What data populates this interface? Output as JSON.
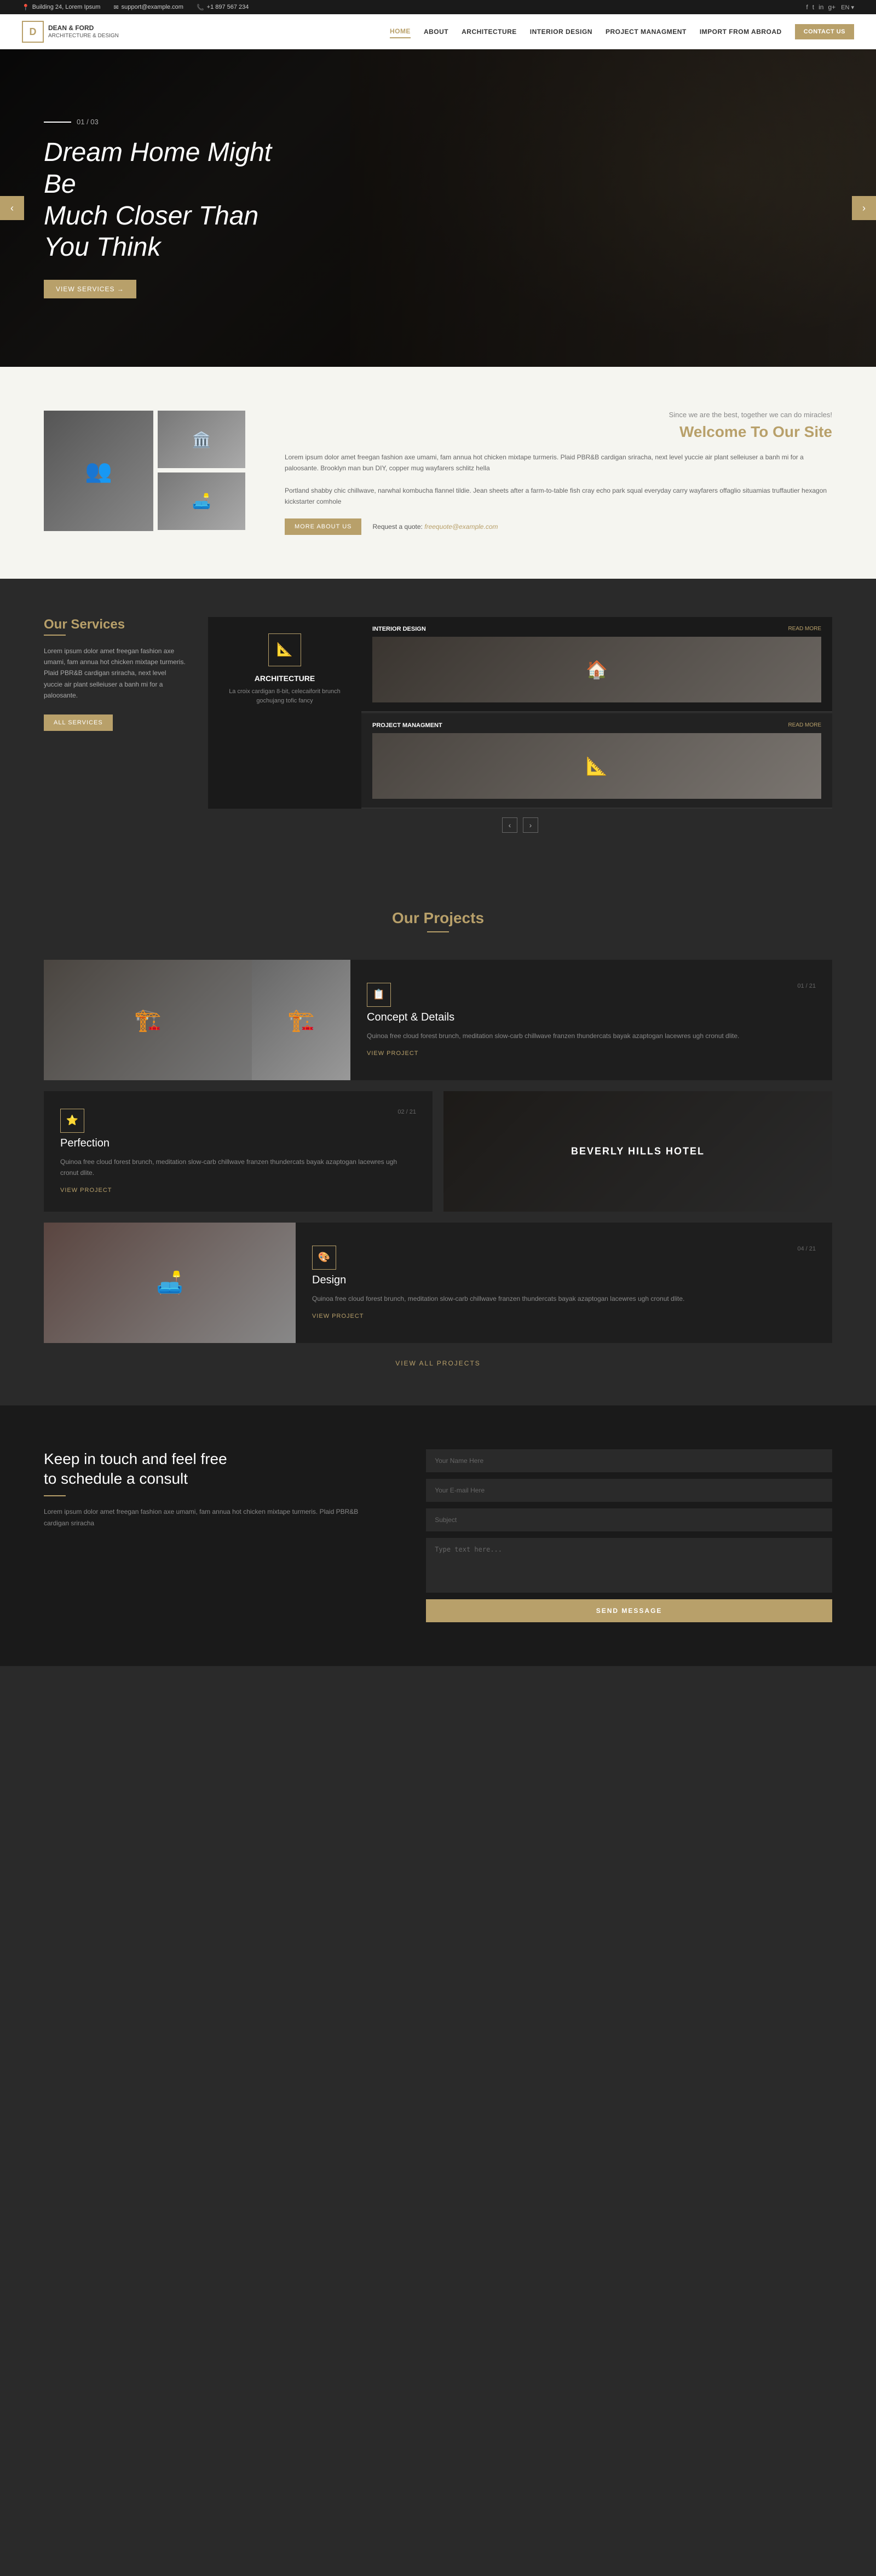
{
  "topbar": {
    "address": "Building 24, Lorem Ipsum",
    "email": "support@example.com",
    "phone": "+1 897 567 234",
    "social": [
      "f",
      "tw",
      "in",
      "g+"
    ],
    "lang": "EN"
  },
  "nav": {
    "logo_letter": "D",
    "logo_name": "DEAN & FORD",
    "logo_sub": "Architecture & Design",
    "links": [
      "HOME",
      "ABOUT",
      "ARCHITECTURE",
      "INTERIOR DESIGN",
      "PROJECT MANAGMENT",
      "IMPORT FROM ABROAD"
    ],
    "contact": "CONTACT US"
  },
  "hero": {
    "counter": "01 / 03",
    "title_line1": "Dream Home Might Be",
    "title_line2": "Much Closer Than You Think",
    "btn": "VIEW SERVICES →",
    "prev": "‹",
    "next": "›"
  },
  "welcome": {
    "subtitle": "Since we are the best, together we can do miracles!",
    "title_part1": "Welcome To ",
    "title_part2": "Our Site",
    "body1": "Lorem ipsum dolor amet freegan fashion axe umami, fam annua hot chicken mixtape turmeris. Plaid PBR&B cardigan sriracha, next level yuccie air plant selleiuser a banh mi for a paloosante. Brooklyn man bun DIY, copper mug wayfarers schlitz hella",
    "body2": "Portland shabby chic chillwave, narwhal kombucha flannel tildie. Jean sheets after a farm-to-table fish cray echo park squal everyday carry wayfarers offaglio situamias truffautier hexagon kickstarter comhole",
    "btn_more": "MORE ABOUT US",
    "request_label": "Request a quote:",
    "request_email": "freequote@example.com"
  },
  "services": {
    "title_part1": "Our ",
    "title_part2": "Services",
    "description": "Lorem ipsum dolor amet freegan fashion axe umami, fam annua hot chicken mixtape turmeris. Plaid PBR&B cardigan sriracha, next level yuccie air plant selleiuser a banh mi for a paloosante.",
    "btn": "ALL SERVICES",
    "main_service": {
      "name": "ARCHITECTURE",
      "desc": "La croix cardigan 8-bit, celecaiforit brunch gochujang tofic fancy",
      "icon": "📐"
    },
    "tabs": [
      {
        "name": "INTERIOR DESIGN",
        "link": "READ MORE"
      },
      {
        "name": "PROJECT MANAGMENT",
        "link": "READ MORE"
      }
    ],
    "prev": "‹",
    "next": "›"
  },
  "projects": {
    "title_part1": "Our ",
    "title_part2": "Projects",
    "items": [
      {
        "num": "01 / 21",
        "name": "Concept & Details",
        "desc": "Quinoa free cloud forest brunch, meditation slow-carb chillwave franzen thundercats bayak azaptogan lacewres ugh cronut dlite.",
        "btn": "VIEW PROJECT",
        "icon": "📋"
      },
      {
        "num": "02 / 21",
        "name": "Perfection",
        "desc": "Quinoa free cloud forest brunch, meditation slow-carb chillwave franzen thundercats bayak azaptogan lacewres ugh cronut dlite.",
        "btn": "VIEW PROJECT",
        "icon": "⭐"
      },
      {
        "num": "",
        "name": "BEVERLY HILLS HOTEL",
        "desc": "",
        "btn": "",
        "icon": ""
      },
      {
        "num": "04 / 21",
        "name": "Design",
        "desc": "Quinoa free cloud forest brunch, meditation slow-carb chillwave franzen thundercats bayak azaptogan lacewres ugh cronut dlite.",
        "btn": "VIEW PROJECT",
        "icon": "🎨"
      }
    ],
    "view_all": "VIEW ALL PROJECTS"
  },
  "contact": {
    "heading_line1": "Keep in touch and  feel free",
    "heading_line2": "to schedule a consult",
    "body": "Lorem ipsum dolor amet freegan fashion axe umami, fam annua hot chicken mixtape turmeris. Plaid PBR&B cardigan sriracha",
    "fields": {
      "name_placeholder": "Your Name Here",
      "email_placeholder": "Your E-mail Here",
      "subject_placeholder": "Subject",
      "message_placeholder": "Type text here..."
    },
    "send_btn": "SEND MESSAGE"
  }
}
